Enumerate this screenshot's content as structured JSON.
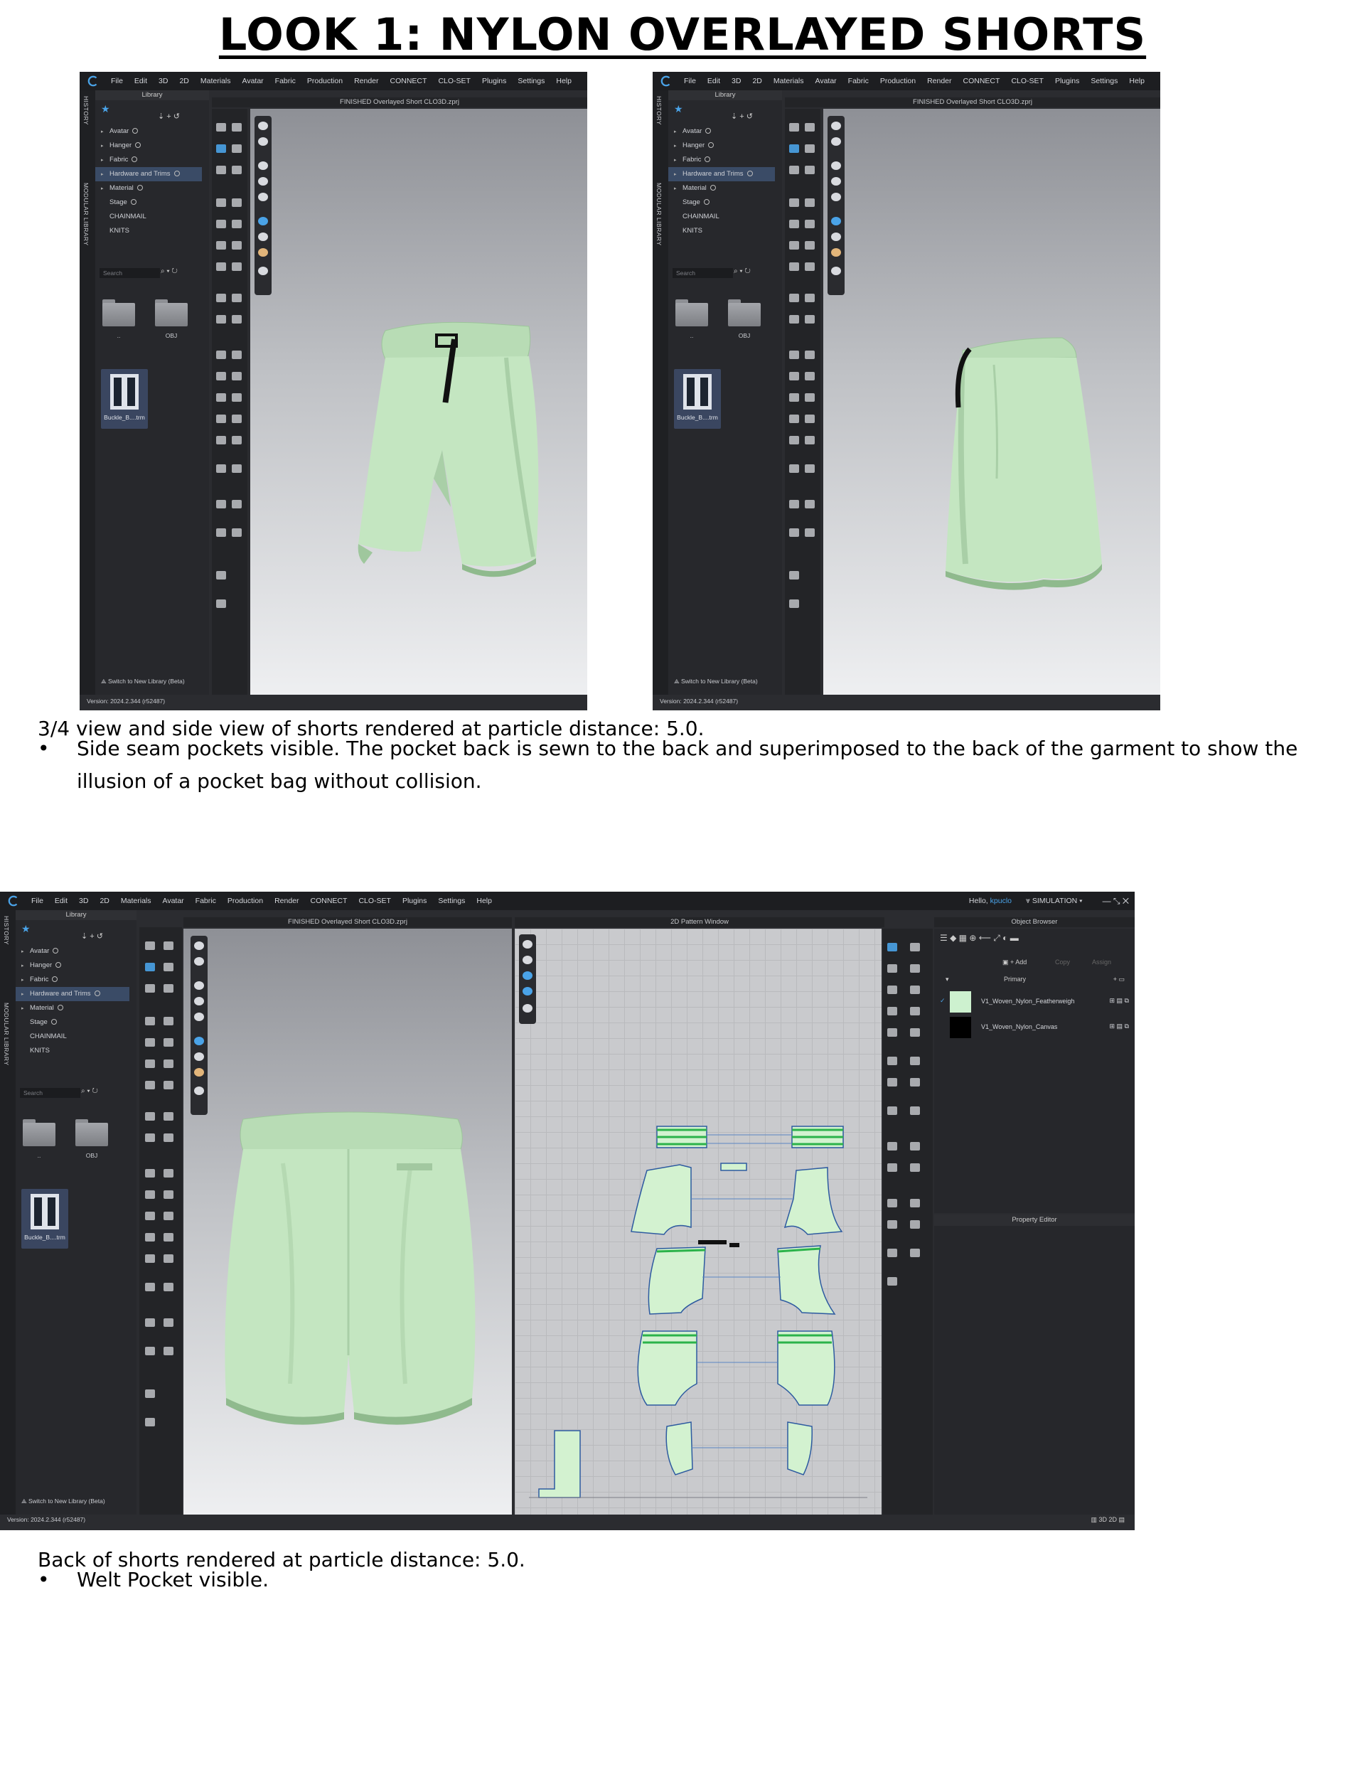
{
  "page_title": "LOOK 1: NYLON OVERLAYED SHORTS",
  "menu": [
    "File",
    "Edit",
    "3D",
    "2D",
    "Materials",
    "Avatar",
    "Fabric",
    "Production",
    "Render",
    "CONNECT",
    "CLO-SET",
    "Plugins",
    "Settings",
    "Help"
  ],
  "window_title": "FINISHED Overlayed Short CLO3D.zprj",
  "side_tabs": {
    "history": "HISTORY",
    "modular": "MODULAR LIBRARY"
  },
  "library": {
    "header": "Library",
    "tree": [
      "Avatar",
      "Hanger",
      "Fabric",
      "Hardware and Trims",
      "Material",
      "Stage",
      "CHAINMAIL",
      "KNITS"
    ],
    "search_placeholder": "Search",
    "folders": [
      "..",
      "OBJ"
    ],
    "file_label": "Buckle_B....trm",
    "switch_label": "Switch to New Library (Beta)"
  },
  "version": "Version: 2024.2.344 (r52487)",
  "caption1": "3/4 view and side view of shorts rendered at particle distance: 5.0.",
  "bullet1": "Side seam pockets visible. The pocket back is sewn to the back and superimposed to the back of the garment to show the illusion of a pocket bag without collision.",
  "wide": {
    "greeting": "Hello,",
    "user": "kpuclo",
    "mode": "SIMULATION",
    "pattern_title": "2D Pattern Window",
    "object_browser": "Object Browser",
    "add_label": "+ Add",
    "copy_label": "Copy",
    "assign_label": "Assign",
    "primary_label": "Primary",
    "fabrics": [
      {
        "name": "V1_Woven_Nylon_Featherweigh",
        "color": "#cdf1cf"
      },
      {
        "name": "V1_Woven_Nylon_Canvas",
        "color": "#000000"
      }
    ],
    "property_editor": "Property Editor"
  },
  "caption2": "Back of shorts rendered at particle distance: 5.0.",
  "bullet2": "Welt Pocket visible.",
  "colors": {
    "garment": "#c4e6c1",
    "garment_shade": "#a9cfa7",
    "pattern_fill": "#d3f2d0",
    "pattern_edge": "#2d5aa0",
    "accent": "#4aa3e8"
  }
}
